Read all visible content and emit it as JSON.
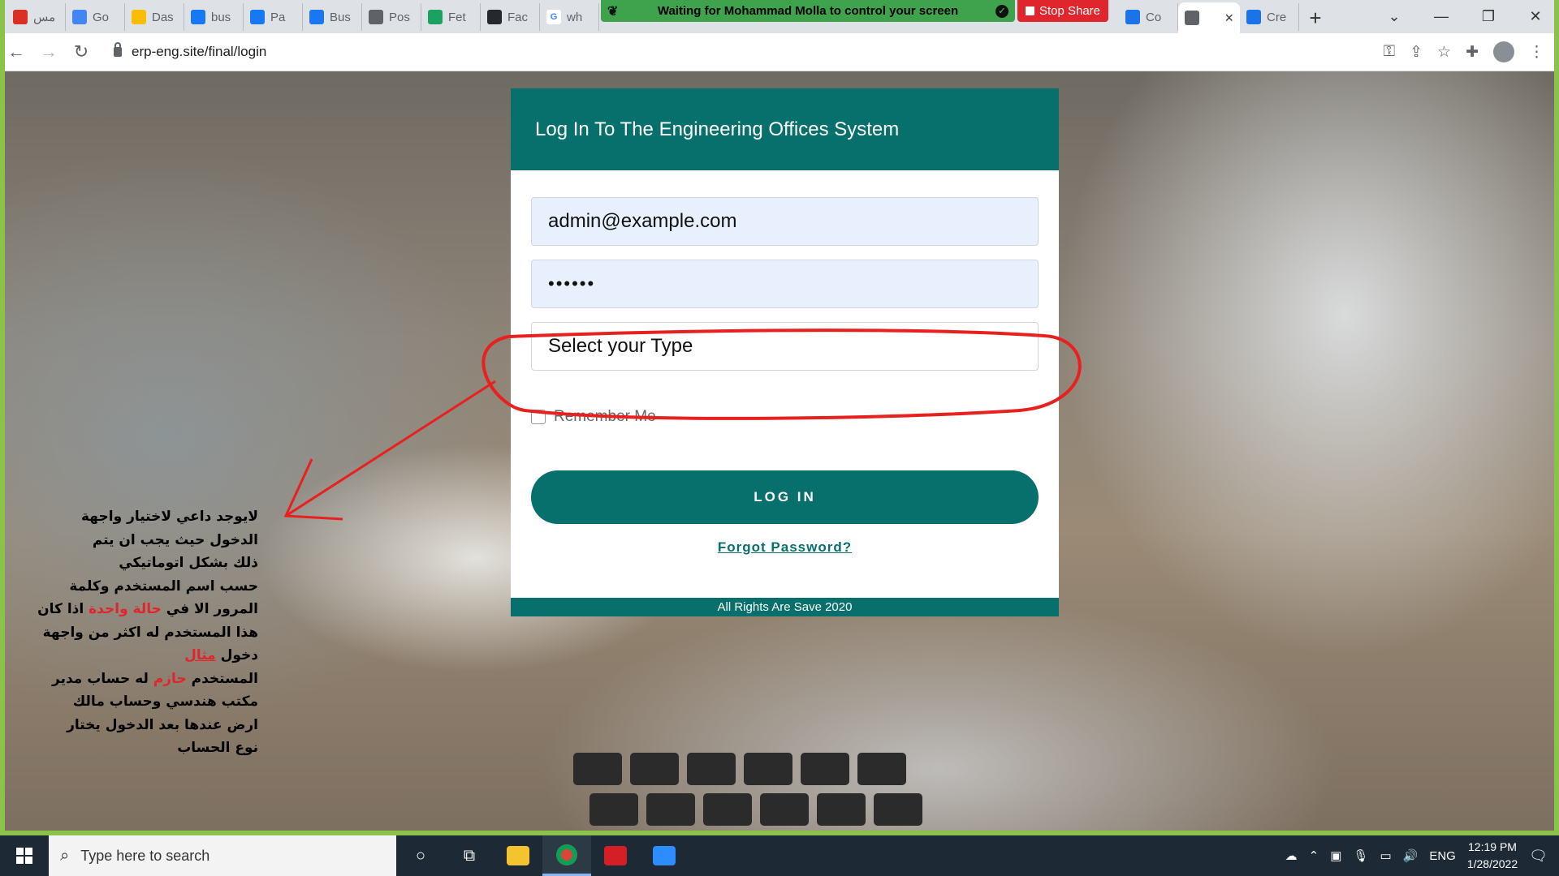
{
  "browser": {
    "tabs": [
      {
        "label": "مس",
        "icon": "red-app-icon",
        "color": "#d93025"
      },
      {
        "label": "Go",
        "icon": "google-translate-icon",
        "color": "#4285f4"
      },
      {
        "label": "Das",
        "icon": "google-ads-icon",
        "color": "#fbbc04"
      },
      {
        "label": "bus",
        "icon": "facebook-icon",
        "color": "#1877f2"
      },
      {
        "label": "Pa",
        "icon": "facebook-icon",
        "color": "#1877f2"
      },
      {
        "label": "Bus",
        "icon": "facebook-icon",
        "color": "#1877f2"
      },
      {
        "label": "Pos",
        "icon": "globe-icon",
        "color": "#5f6368"
      },
      {
        "label": "Fet",
        "icon": "cw-icon",
        "color": "#1aa260"
      },
      {
        "label": "Fac",
        "icon": "github-icon",
        "color": "#24292e"
      },
      {
        "label": "wh",
        "icon": "google-icon",
        "color": "#ffffff"
      }
    ],
    "tabs_after": [
      {
        "label": "Co",
        "icon": "app-icon",
        "color": "#1a73e8"
      },
      {
        "label": "",
        "icon": "globe-icon",
        "color": "#5f6368",
        "active": true
      },
      {
        "label": "Cre",
        "icon": "app-icon",
        "color": "#1a73e8"
      }
    ],
    "url": "erp-eng.site/final/login"
  },
  "screen_share": {
    "banner": "Waiting for Mohammad Molla to control your screen",
    "stop_label": "Stop Share",
    "banner_color": "#3fa34d",
    "stop_color": "#e0252d"
  },
  "login": {
    "header": "Log In To The Engineering Offices System",
    "email_value": "admin@example.com",
    "password_value": "••••••",
    "type_placeholder": "Select your Type",
    "remember_label": "Remember Me",
    "login_button": "LOG IN",
    "forgot_link": "Forgot Password?",
    "footer": "All Rights Are Save 2020",
    "accent_color": "#07706c"
  },
  "annotation": {
    "line1": "لايوجد داعي لاختيار واجهة",
    "line2": "الدخول حيث يجب ان يتم",
    "line3": "ذلك بشكل اتوماتيكي",
    "line4": "حسب اسم المستخدم وكلمة",
    "line5_a": "المرور الا في ",
    "line5_red": "حالة واحدة",
    "line5_b": " اذا كان",
    "line6": "هذا المستخدم له اكثر من واجهة",
    "line7_a": "دخول ",
    "line7_red": "مثال",
    "line8_a": "المستخدم ",
    "line8_red": "حازم",
    "line8_b": " له حساب مدير",
    "line9": "مكتب هندسي وحساب مالك",
    "line10": "ارض عندها بعد الدخول يختار",
    "line11": "نوع الحساب",
    "color": "#e0252d"
  },
  "taskbar": {
    "search_placeholder": "Type here to search",
    "language": "ENG",
    "time": "12:19 PM",
    "date": "1/28/2022"
  }
}
